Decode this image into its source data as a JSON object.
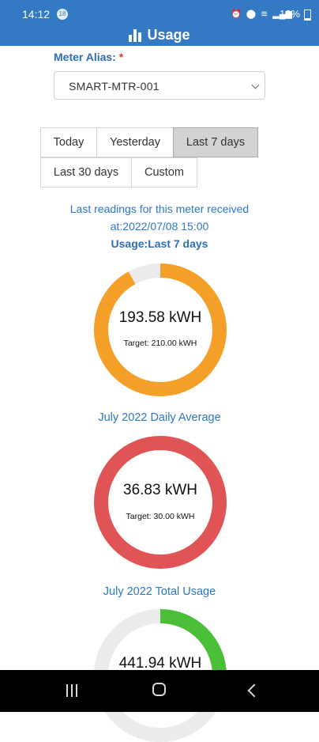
{
  "status_bar": {
    "time": "14:12",
    "notification_count": "18",
    "battery": "13%"
  },
  "header": {
    "title": "Usage",
    "icon": "bar-chart-icon"
  },
  "meter": {
    "label": "Meter Alias:",
    "required_mark": "*",
    "selected": "SMART-MTR-001"
  },
  "ranges": {
    "today": "Today",
    "yesterday": "Yesterday",
    "last7": "Last 7 days",
    "last30": "Last 30 days",
    "custom": "Custom",
    "active": "Last 7 days"
  },
  "readings": {
    "line1": "Last readings for this meter received",
    "line2": "at:2022/07/08 15:00"
  },
  "usage_caption": "Usage:Last 7 days",
  "gauges": [
    {
      "value": "193.58 kWH",
      "target": "Target: 210.00 kWH",
      "fraction": 0.92,
      "color": "#f4a028",
      "track": "#ebebeb"
    },
    {
      "caption": "July 2022 Daily Average",
      "value": "36.83 kWH",
      "target": "Target: 30.00 kWH",
      "fraction": 1.0,
      "color": "#e05455",
      "track": "#ebebeb"
    },
    {
      "caption": "July 2022 Total Usage",
      "value": "441.94 kWH",
      "fraction": 0.25,
      "color": "#4cbf39",
      "track": "#ebebeb"
    }
  ],
  "nav": {
    "recents": "recents-icon",
    "home": "home-icon",
    "back": "back-icon"
  },
  "colors": {
    "primary": "#3479c4",
    "link_text": "#2c78c8",
    "required": "#e0312f"
  }
}
